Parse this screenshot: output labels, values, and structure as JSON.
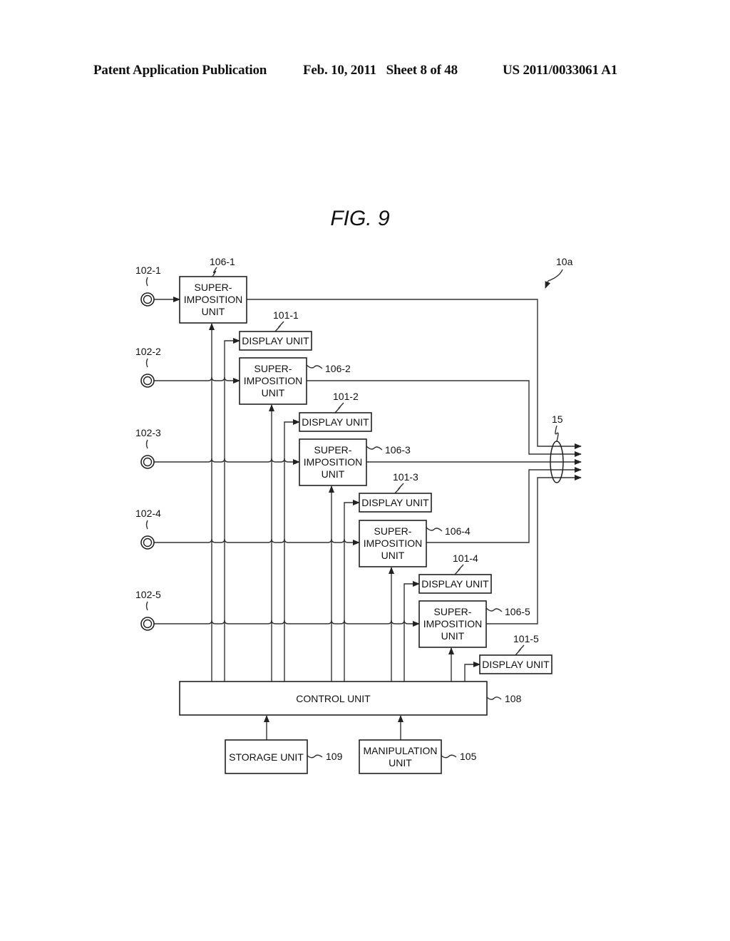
{
  "header": {
    "publication": "Patent Application Publication",
    "date_sheet": "Feb. 10, 2011   Sheet 8 of 48",
    "number": "US 2011/0033061 A1"
  },
  "figure": {
    "title": "FIG. 9",
    "system_ref": "10a",
    "output_bundle_ref": "15",
    "inputs": [
      "102-1",
      "102-2",
      "102-3",
      "102-4",
      "102-5"
    ],
    "superimposition_units": [
      {
        "ref": "106-1",
        "lines": [
          "SUPER-",
          "IMPOSITION",
          "UNIT"
        ]
      },
      {
        "ref": "106-2",
        "lines": [
          "SUPER-",
          "IMPOSITION",
          "UNIT"
        ]
      },
      {
        "ref": "106-3",
        "lines": [
          "SUPER-",
          "IMPOSITION",
          "UNIT"
        ]
      },
      {
        "ref": "106-4",
        "lines": [
          "SUPER-",
          "IMPOSITION",
          "UNIT"
        ]
      },
      {
        "ref": "106-5",
        "lines": [
          "SUPER-",
          "IMPOSITION",
          "UNIT"
        ]
      }
    ],
    "display_units": [
      {
        "ref": "101-1",
        "label": "DISPLAY UNIT"
      },
      {
        "ref": "101-2",
        "label": "DISPLAY UNIT"
      },
      {
        "ref": "101-3",
        "label": "DISPLAY UNIT"
      },
      {
        "ref": "101-4",
        "label": "DISPLAY UNIT"
      },
      {
        "ref": "101-5",
        "label": "DISPLAY UNIT"
      }
    ],
    "control_unit": {
      "ref": "108",
      "label": "CONTROL UNIT"
    },
    "storage_unit": {
      "ref": "109",
      "label": "STORAGE UNIT"
    },
    "manipulation_unit": {
      "ref": "105",
      "lines": [
        "MANIPULATION",
        "UNIT"
      ]
    }
  }
}
